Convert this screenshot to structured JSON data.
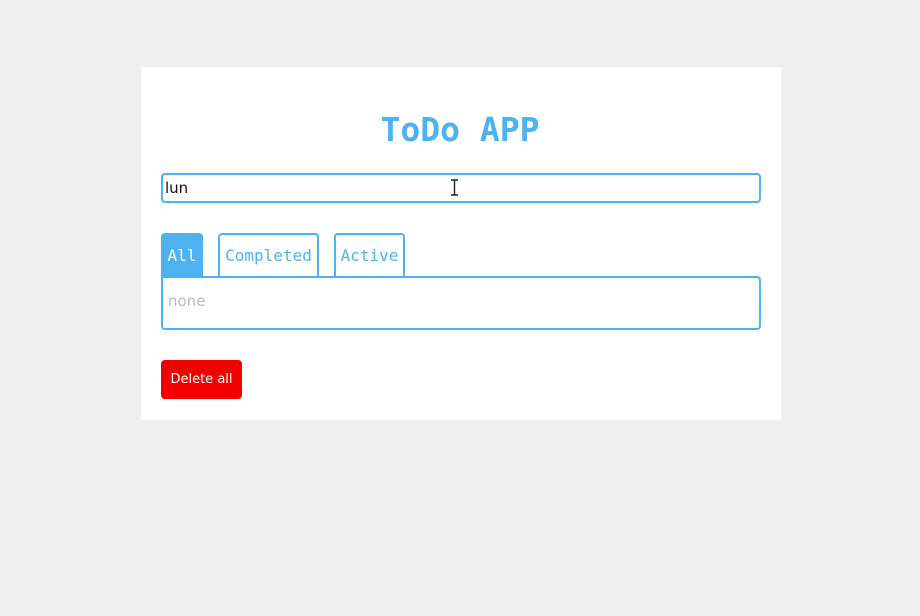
{
  "app": {
    "title": "ToDo APP"
  },
  "input": {
    "value": "lun",
    "placeholder": ""
  },
  "tabs": [
    {
      "label": "All",
      "active": true
    },
    {
      "label": "Completed",
      "active": false
    },
    {
      "label": "Active",
      "active": false
    }
  ],
  "list": {
    "empty_text": "none"
  },
  "actions": {
    "delete_all_label": "Delete all"
  },
  "colors": {
    "accent": "#4db3f0",
    "danger": "#f20000",
    "background": "#eeeeee",
    "card": "#ffffff"
  },
  "icons": {
    "cursor": "text-cursor-icon"
  }
}
